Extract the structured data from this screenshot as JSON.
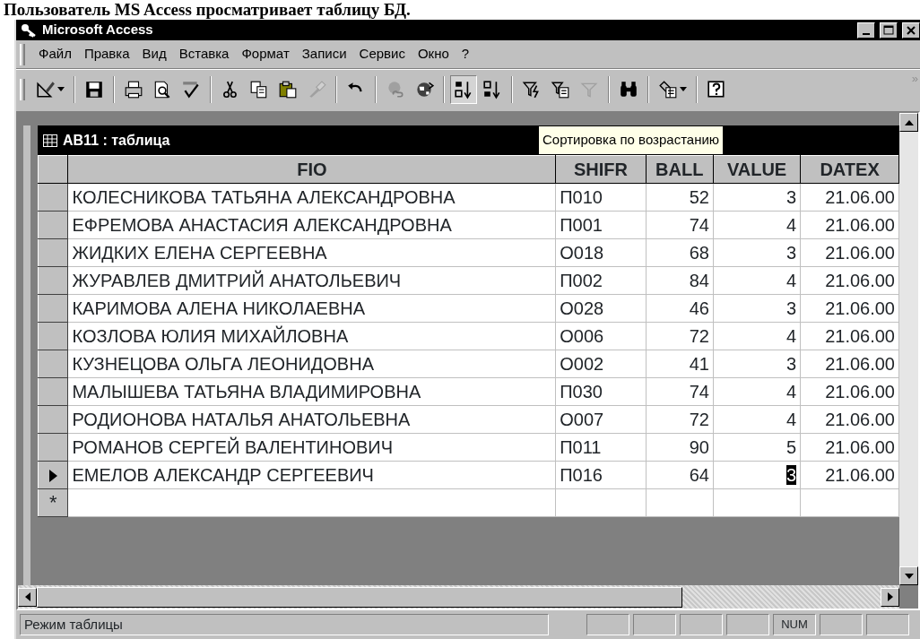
{
  "heading": "Пользователь MS Access просматривает таблицу БД.",
  "window": {
    "title": "Microsoft Access"
  },
  "menu": [
    {
      "label": "Файл"
    },
    {
      "label": "Правка"
    },
    {
      "label": "Вид"
    },
    {
      "label": "Вставка"
    },
    {
      "label": "Формат"
    },
    {
      "label": "Записи"
    },
    {
      "label": "Сервис"
    },
    {
      "label": "Окно"
    },
    {
      "label": "?"
    }
  ],
  "toolbar": [
    {
      "kind": "view",
      "dropdown": true,
      "pressed": false
    },
    {
      "kind": "separator"
    },
    {
      "kind": "save",
      "dropdown": false,
      "pressed": false
    },
    {
      "kind": "separator"
    },
    {
      "kind": "print",
      "dropdown": false,
      "pressed": false
    },
    {
      "kind": "preview",
      "dropdown": false,
      "pressed": false
    },
    {
      "kind": "spell",
      "dropdown": false,
      "pressed": false
    },
    {
      "kind": "separator"
    },
    {
      "kind": "cut",
      "dropdown": false,
      "pressed": false
    },
    {
      "kind": "copy",
      "dropdown": false,
      "pressed": false
    },
    {
      "kind": "paste",
      "dropdown": false,
      "pressed": false
    },
    {
      "kind": "painter",
      "dropdown": false,
      "pressed": false
    },
    {
      "kind": "separator"
    },
    {
      "kind": "undo",
      "dropdown": false,
      "pressed": false
    },
    {
      "kind": "separator"
    },
    {
      "kind": "hyperlink",
      "dropdown": false,
      "pressed": false
    },
    {
      "kind": "web",
      "dropdown": false,
      "pressed": false
    },
    {
      "kind": "separator"
    },
    {
      "kind": "sort_asc",
      "dropdown": false,
      "pressed": true
    },
    {
      "kind": "sort_desc",
      "dropdown": false,
      "pressed": false
    },
    {
      "kind": "separator"
    },
    {
      "kind": "filter_selection",
      "dropdown": false,
      "pressed": false
    },
    {
      "kind": "filter_form",
      "dropdown": false,
      "pressed": false
    },
    {
      "kind": "apply_filter",
      "dropdown": false,
      "pressed": false
    },
    {
      "kind": "separator"
    },
    {
      "kind": "find",
      "dropdown": false,
      "pressed": false
    },
    {
      "kind": "separator"
    },
    {
      "kind": "new_object",
      "dropdown": true,
      "pressed": false
    },
    {
      "kind": "separator"
    },
    {
      "kind": "help",
      "dropdown": false,
      "pressed": false
    }
  ],
  "toolbar_overflow": "»",
  "datasheet": {
    "title": "АВ11 : таблица",
    "tooltip": "Сортировка по возрастанию",
    "columns": [
      {
        "label": "FIO",
        "kind": "string"
      },
      {
        "label": "SHIFR",
        "kind": "string"
      },
      {
        "label": "BALL",
        "kind": "numeric"
      },
      {
        "label": "VALUE",
        "kind": "numeric"
      },
      {
        "label": "DATEX",
        "kind": "numeric"
      }
    ],
    "rows": [
      {
        "cells": [
          "КОЛЕСНИКОВА ТАТЬЯНА АЛЕКСАНДРОВНА",
          "П010",
          "52",
          "3",
          "21.06.00"
        ],
        "current": false
      },
      {
        "cells": [
          "ЕФРЕМОВА АНАСТАСИЯ АЛЕКСАНДРОВНА",
          "П001",
          "74",
          "4",
          "21.06.00"
        ],
        "current": false
      },
      {
        "cells": [
          "ЖИДКИХ ЕЛЕНА СЕРГЕЕВНА",
          "О018",
          "68",
          "3",
          "21.06.00"
        ],
        "current": false
      },
      {
        "cells": [
          "ЖУРАВЛЕВ ДМИТРИЙ АНАТОЛЬЕВИЧ",
          "П002",
          "84",
          "4",
          "21.06.00"
        ],
        "current": false
      },
      {
        "cells": [
          "КАРИМОВА АЛЕНА НИКОЛАЕВНА",
          "О028",
          "46",
          "3",
          "21.06.00"
        ],
        "current": false
      },
      {
        "cells": [
          "КОЗЛОВА ЮЛИЯ МИХАЙЛОВНА",
          "О006",
          "72",
          "4",
          "21.06.00"
        ],
        "current": false
      },
      {
        "cells": [
          "КУЗНЕЦОВА ОЛЬГА ЛЕОНИДОВНА",
          "О002",
          "41",
          "3",
          "21.06.00"
        ],
        "current": false
      },
      {
        "cells": [
          "МАЛЫШЕВА ТАТЬЯНА ВЛАДИМИРОВНА",
          "П030",
          "74",
          "4",
          "21.06.00"
        ],
        "current": false
      },
      {
        "cells": [
          "РОДИОНОВА НАТАЛЬЯ АНАТОЛЬЕВНА",
          "О007",
          "72",
          "4",
          "21.06.00"
        ],
        "current": false
      },
      {
        "cells": [
          "РОМАНОВ СЕРГЕЙ ВАЛЕНТИНОВИЧ",
          "П011",
          "90",
          "5",
          "21.06.00"
        ],
        "current": false
      },
      {
        "cells": [
          "ЕМЕЛОВ АЛЕКСАНДР СЕРГЕЕВИЧ",
          "П016",
          "64",
          "3",
          "21.06.00"
        ],
        "current": true
      }
    ],
    "new_row_marker": "*"
  },
  "status_bar": {
    "text": "Режим таблицы",
    "indicator": "NUM"
  }
}
